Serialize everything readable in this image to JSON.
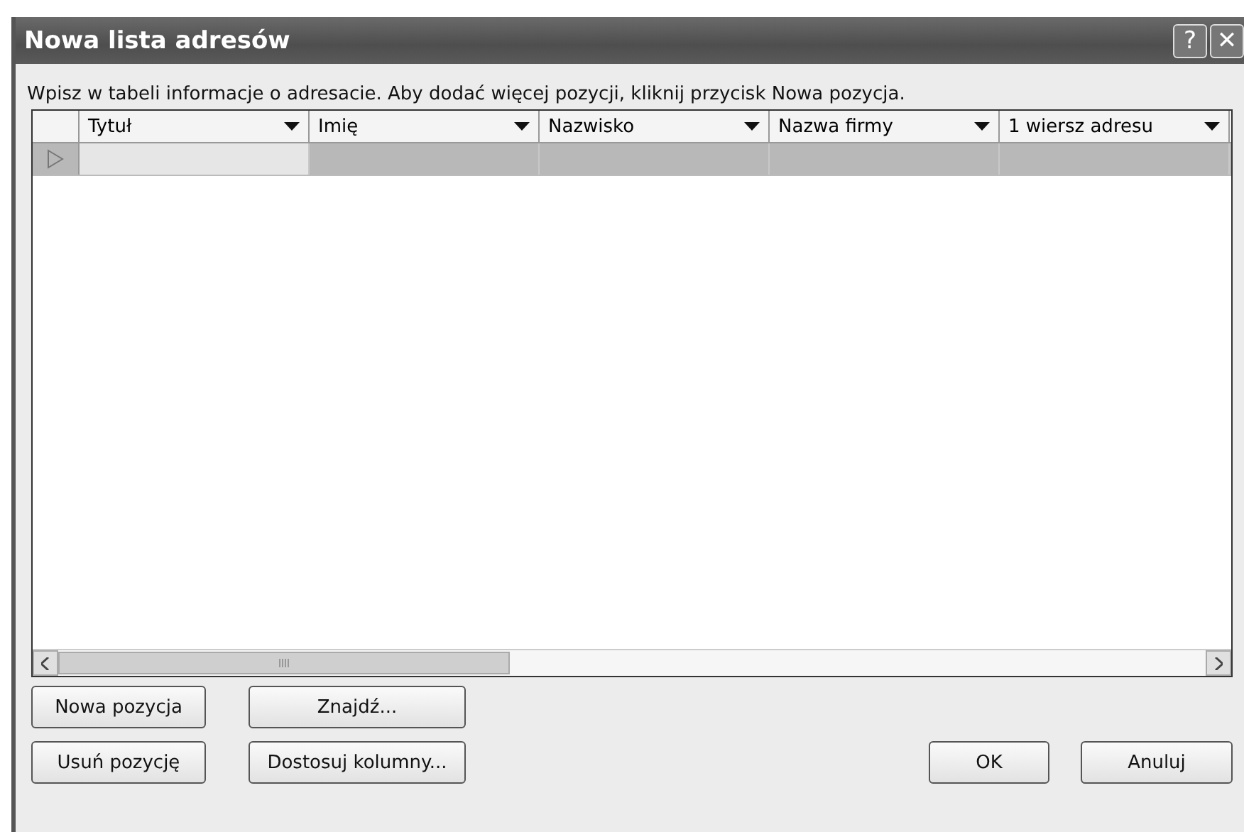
{
  "window": {
    "title": "Nowa lista adresów",
    "help_button": "?",
    "close_button": "✕"
  },
  "instruction": {
    "text": "Wpisz w tabeli informacje o adresacie. Aby dodać więcej pozycji, kliknij przycisk Nowa pozycja."
  },
  "table": {
    "columns": [
      "Tytuł",
      "Imię",
      "Nazwisko",
      "Nazwa firmy",
      "1 wiersz adresu"
    ],
    "rows": [
      {
        "selected": true
      }
    ]
  },
  "buttons": [
    {
      "label": "Nowa pozycja",
      "kind": "left"
    },
    {
      "label": "Znajdź...",
      "kind": "left"
    },
    {
      "label": "Usuń pozycję",
      "kind": "left"
    },
    {
      "label": "Dostosuj kolumny...",
      "kind": "left"
    },
    {
      "label": "OK",
      "kind": "right"
    },
    {
      "label": "Anuluj",
      "kind": "right"
    }
  ]
}
